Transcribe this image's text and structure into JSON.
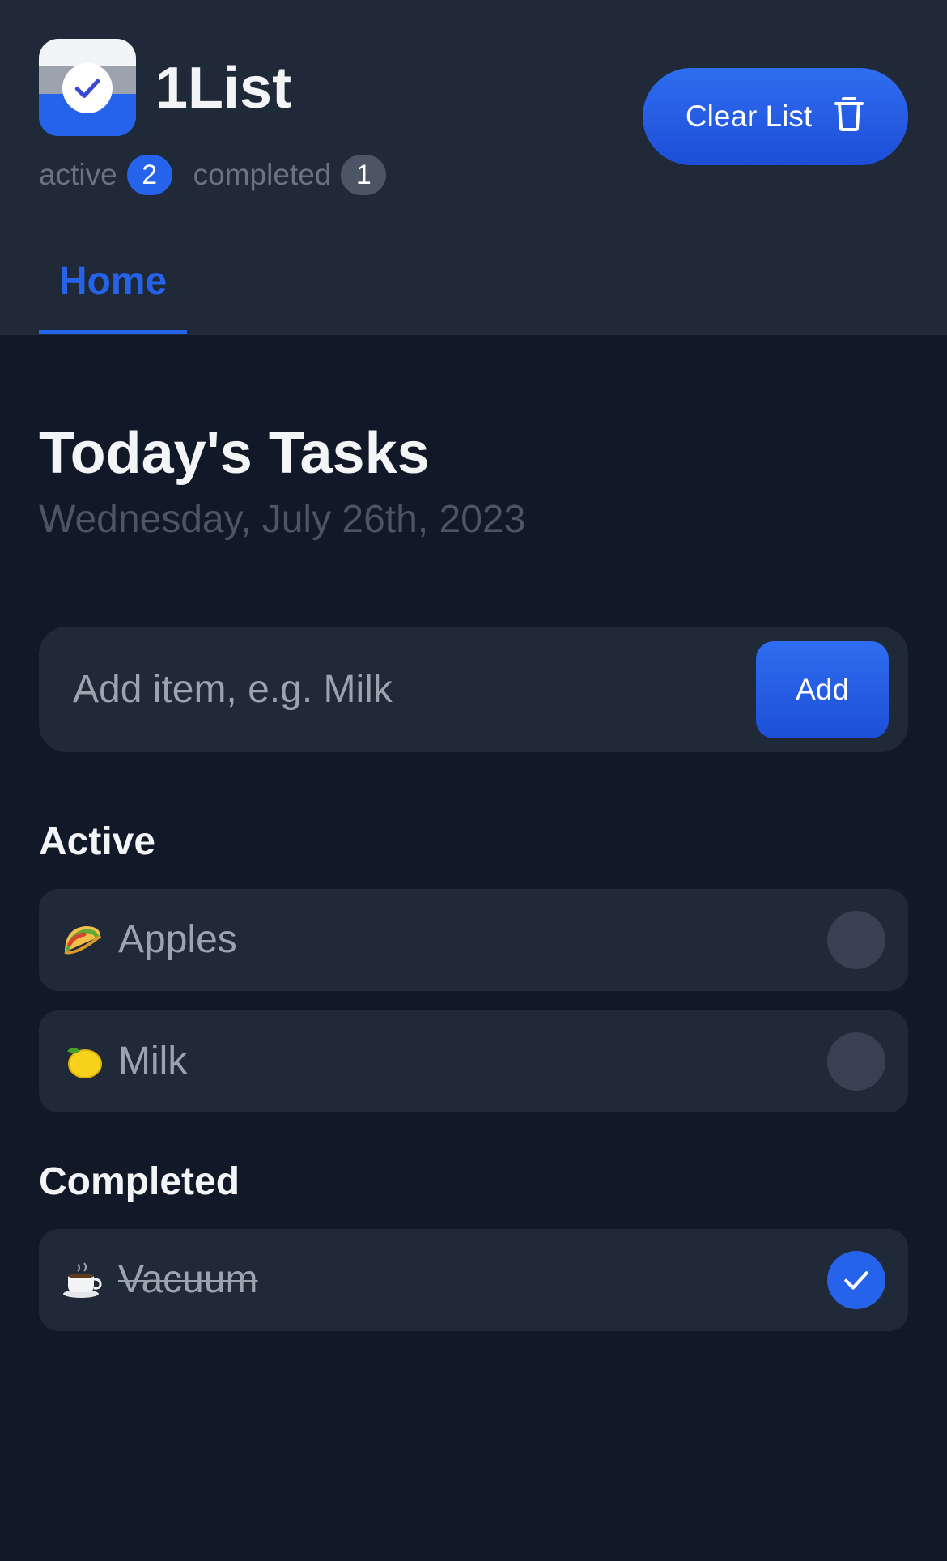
{
  "app": {
    "title": "1List",
    "brand_color": "#2563eb"
  },
  "stats": {
    "active_label": "active",
    "active_count": "2",
    "completed_label": "completed",
    "completed_count": "1"
  },
  "header": {
    "clear_label": "Clear List",
    "clear_icon": "trash-icon"
  },
  "tabs": [
    {
      "label": "Home",
      "selected": true
    }
  ],
  "main": {
    "title": "Today's Tasks",
    "date": "Wednesday, July 26th, 2023"
  },
  "add_form": {
    "placeholder": "Add item, e.g. Milk",
    "value": "",
    "button_label": "Add"
  },
  "sections": {
    "active_heading": "Active",
    "completed_heading": "Completed"
  },
  "active_items": [
    {
      "name": "Apples",
      "icon": "taco-emoji",
      "completed": false
    },
    {
      "name": "Milk",
      "icon": "lemon-emoji",
      "completed": false
    }
  ],
  "completed_items": [
    {
      "name": "Vacuum",
      "icon": "coffee-emoji",
      "completed": true
    }
  ]
}
